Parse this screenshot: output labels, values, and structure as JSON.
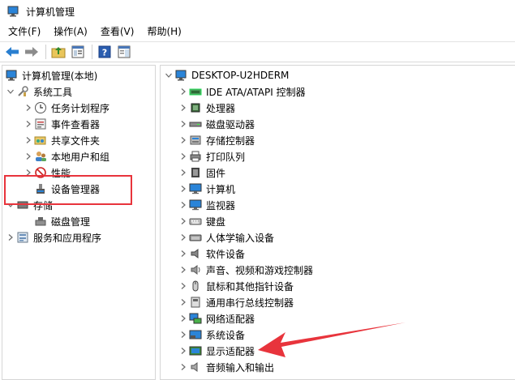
{
  "window": {
    "title": "计算机管理"
  },
  "menu": {
    "items": [
      "文件(F)",
      "操作(A)",
      "查看(V)",
      "帮助(H)"
    ]
  },
  "left_tree": {
    "root": "计算机管理(本地)",
    "system_tools": "系统工具",
    "task_scheduler": "任务计划程序",
    "event_viewer": "事件查看器",
    "shared_folders": "共享文件夹",
    "local_users": "本地用户和组",
    "performance": "性能",
    "device_manager": "设备管理器",
    "storage": "存储",
    "disk_management": "磁盘管理",
    "services_apps": "服务和应用程序"
  },
  "right_tree": {
    "computer_name": "DESKTOP-U2HDERM",
    "categories": [
      "IDE ATA/ATAPI 控制器",
      "处理器",
      "磁盘驱动器",
      "存储控制器",
      "打印队列",
      "固件",
      "计算机",
      "监视器",
      "键盘",
      "人体学输入设备",
      "软件设备",
      "声音、视频和游戏控制器",
      "鼠标和其他指针设备",
      "通用串行总线控制器",
      "网络适配器",
      "系统设备",
      "显示适配器",
      "音频输入和输出"
    ]
  },
  "colors": {
    "highlight_box": "#e8343c",
    "arrow": "#e8343c",
    "icon_blue": "#1e7fd6"
  }
}
